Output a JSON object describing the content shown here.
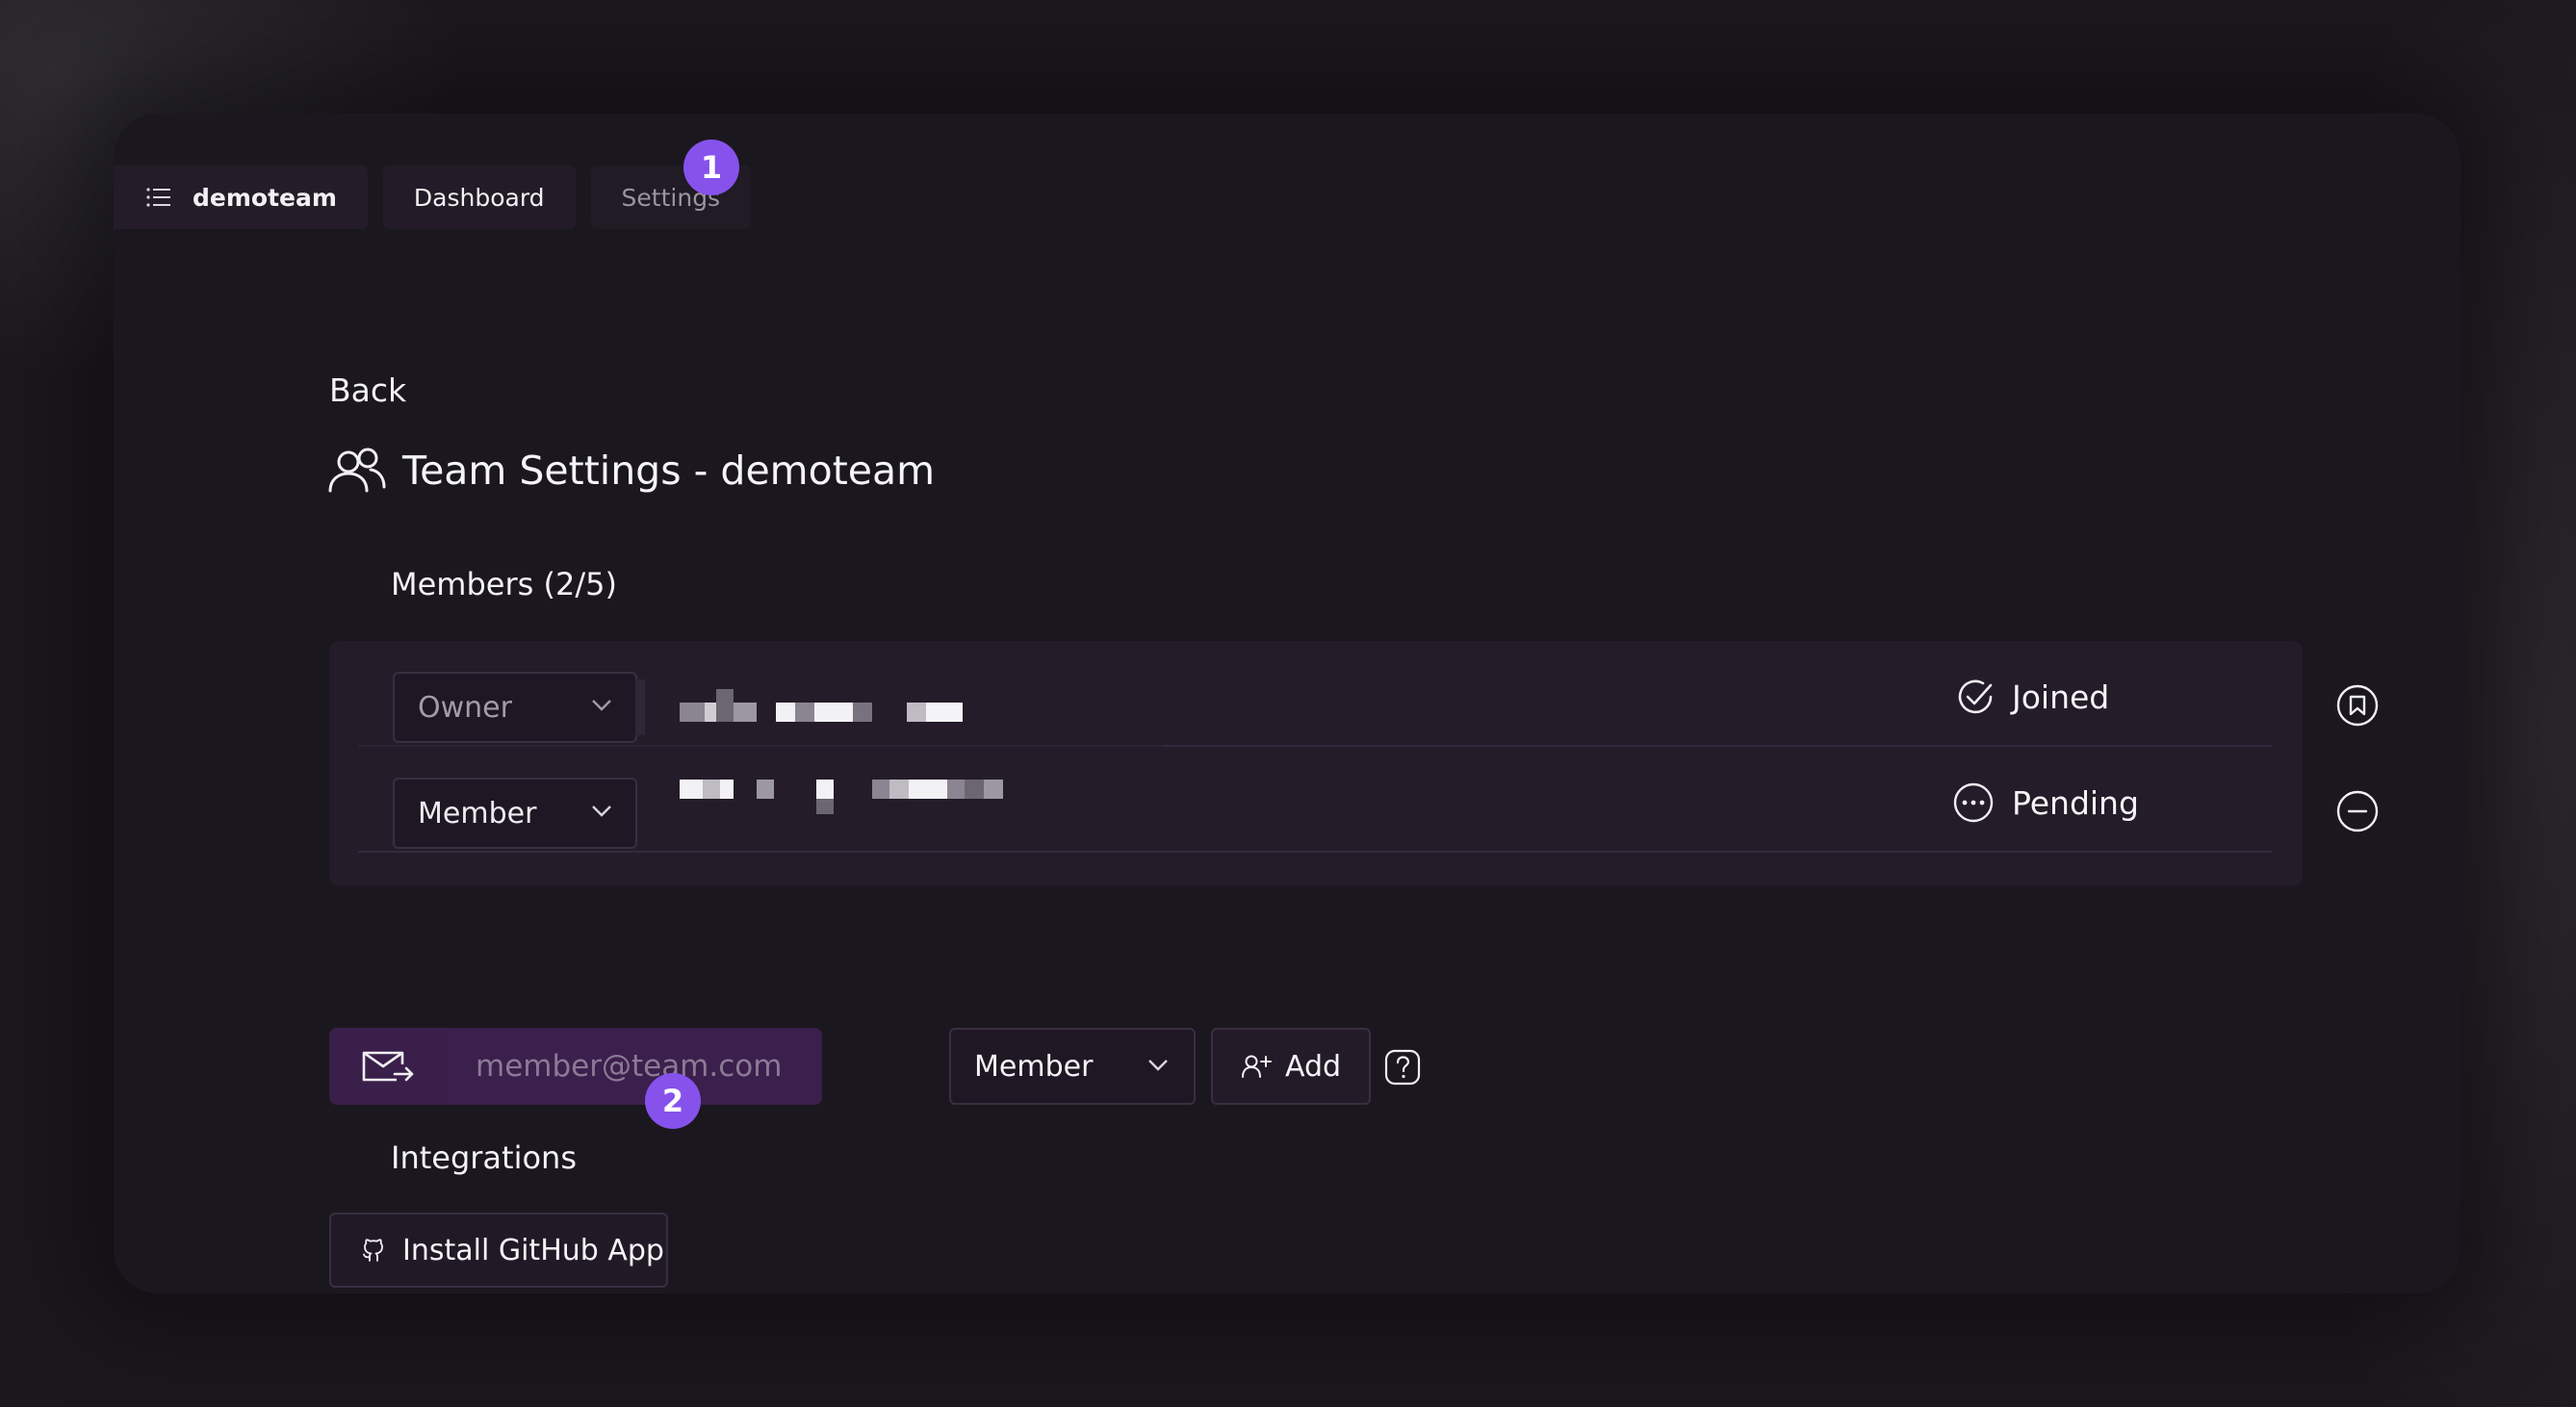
{
  "nav": {
    "team_name": "demoteam",
    "tabs": [
      {
        "label": "Dashboard"
      },
      {
        "label": "Settings"
      }
    ]
  },
  "callouts": [
    "1",
    "2"
  ],
  "back_label": "Back",
  "page_title": "Team Settings - demoteam",
  "members": {
    "heading": "Members (2/5)",
    "rows": [
      {
        "role": "Owner",
        "status": "Joined",
        "status_icon": "check-circle-icon",
        "action_icon": "owner-badge-icon"
      },
      {
        "role": "Member",
        "status": "Pending",
        "status_icon": "dots-circle-icon",
        "action_icon": "remove-circle-icon"
      }
    ]
  },
  "invite": {
    "placeholder": "member@team.com",
    "role": "Member",
    "add_label": "Add",
    "help_icon": "question-icon"
  },
  "integrations": {
    "heading": "Integrations",
    "install_label": "Install GitHub App"
  },
  "colors": {
    "accent": "#8752ec",
    "background": "#1b171f",
    "panel": "#241c29",
    "input_accent": "#3b1f4c"
  }
}
